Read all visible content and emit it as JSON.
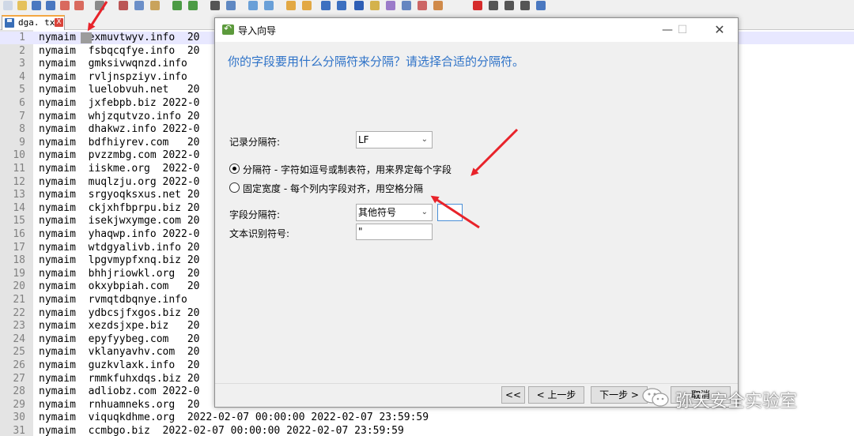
{
  "editor": {
    "tab": {
      "filename": "dga. txt",
      "close_label": "X"
    },
    "lines": [
      {
        "n": "1",
        "text": "nymaim  exmuvtwyv.info  20"
      },
      {
        "n": "2",
        "text": "nymaim  fsbqcqfye.info  20"
      },
      {
        "n": "3",
        "text": "nymaim  gmksivwqnzd.info"
      },
      {
        "n": "4",
        "text": "nymaim  rvljnspziyv.info"
      },
      {
        "n": "5",
        "text": "nymaim  luelobvuh.net   20"
      },
      {
        "n": "6",
        "text": "nymaim  jxfebpb.biz 2022-0"
      },
      {
        "n": "7",
        "text": "nymaim  whjzqutvzo.info 20"
      },
      {
        "n": "8",
        "text": "nymaim  dhakwz.info 2022-0"
      },
      {
        "n": "9",
        "text": "nymaim  bdfhiyrev.com   20"
      },
      {
        "n": "10",
        "text": "nymaim  pvzzmbg.com 2022-0"
      },
      {
        "n": "11",
        "text": "nymaim  iiskme.org  2022-0"
      },
      {
        "n": "12",
        "text": "nymaim  muqlzju.org 2022-0"
      },
      {
        "n": "13",
        "text": "nymaim  srgyoqksxus.net 20"
      },
      {
        "n": "14",
        "text": "nymaim  ckjxhfbprpu.biz 20"
      },
      {
        "n": "15",
        "text": "nymaim  isekjwxymge.com 20"
      },
      {
        "n": "16",
        "text": "nymaim  yhaqwp.info 2022-0"
      },
      {
        "n": "17",
        "text": "nymaim  wtdgyalivb.info 20"
      },
      {
        "n": "18",
        "text": "nymaim  lpgvmypfxnq.biz 20"
      },
      {
        "n": "19",
        "text": "nymaim  bhhjriowkl.org  20"
      },
      {
        "n": "20",
        "text": "nymaim  okxybpiah.com   20"
      },
      {
        "n": "21",
        "text": "nymaim  rvmqtdbqnye.info"
      },
      {
        "n": "22",
        "text": "nymaim  ydbcsjfxgos.biz 20"
      },
      {
        "n": "23",
        "text": "nymaim  xezdsjxpe.biz   20"
      },
      {
        "n": "24",
        "text": "nymaim  epyfyybeg.com   20"
      },
      {
        "n": "25",
        "text": "nymaim  vklanyavhv.com  20"
      },
      {
        "n": "26",
        "text": "nymaim  guzkvlaxk.info  20"
      },
      {
        "n": "27",
        "text": "nymaim  rmmkfuhxdqs.biz 20"
      },
      {
        "n": "28",
        "text": "nymaim  adliobz.com 2022-0"
      },
      {
        "n": "29",
        "text": "nymaim  rnhuamneks.org  20"
      },
      {
        "n": "30",
        "text": "nymaim  viquqkdhme.org  2022-02-07 00:00:00 2022-02-07 23:59:59"
      },
      {
        "n": "31",
        "text": "nymaim  ccmbgo.biz  2022-02-07 00:00:00 2022-02-07 23:59:59"
      }
    ]
  },
  "dialog": {
    "title": "导入向导",
    "heading": "你的字段要用什么分隔符来分隔？请选择合适的分隔符。",
    "record_delimiter": {
      "label": "记录分隔符:",
      "value": "LF"
    },
    "options": [
      {
        "label": "分隔符 - 字符如逗号或制表符，用来界定每个字段",
        "selected": true
      },
      {
        "label": "固定宽度 - 每个列内字段对齐，用空格分隔",
        "selected": false
      }
    ],
    "field_delimiter": {
      "label": "字段分隔符:",
      "value": "其他符号",
      "custom_value": ""
    },
    "text_qualifier": {
      "label": "文本识别符号:",
      "value": "\""
    },
    "buttons": {
      "first": "<<",
      "prev": "< 上一步",
      "next": "下一步 >",
      "last": "取消"
    }
  },
  "watermark": {
    "text": "弥天安全实验室"
  },
  "colors": {
    "heading": "#2f73c8",
    "annotation_arrow": "#e8232a",
    "current_line": "#e8e8ff",
    "tab_accent": "#f4a742"
  }
}
